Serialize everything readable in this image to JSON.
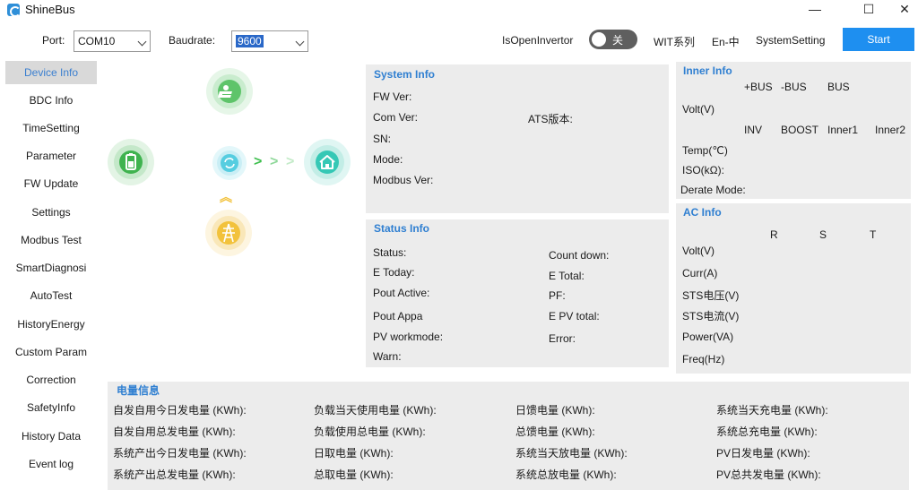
{
  "window": {
    "title": "ShineBus",
    "controls": {
      "minimize": "—",
      "maximize": "☐",
      "close": "✕"
    }
  },
  "toolbar": {
    "port_label": "Port:",
    "port_value": "COM10",
    "baud_label": "Baudrate:",
    "baud_value": "9600",
    "invertor_label": "IsOpenInvertor",
    "toggle_text": "关",
    "wit_label": "WIT系列",
    "lang_label": "En-中",
    "system_setting": "SystemSetting",
    "start_label": "Start"
  },
  "sidebar": {
    "items": [
      {
        "label": "Device Info",
        "active": true
      },
      {
        "label": "BDC Info"
      },
      {
        "label": "TimeSetting"
      },
      {
        "label": "Parameter"
      },
      {
        "label": "FW Update"
      },
      {
        "label": "Settings"
      },
      {
        "label": "Modbus Test"
      },
      {
        "label": "SmartDiagnosi"
      },
      {
        "label": "AutoTest"
      },
      {
        "label": "HistoryEnergy"
      },
      {
        "label": "Custom Param"
      },
      {
        "label": "Correction"
      },
      {
        "label": "SafetyInfo"
      },
      {
        "label": "History Data"
      },
      {
        "label": "Event log"
      }
    ]
  },
  "colors": {
    "accent": "#2f7fd1",
    "start_button": "#1e8ff0",
    "panel_bg": "#ececec",
    "solar_green": "#5ec46a",
    "battery_green": "#3fb34f",
    "converter_cyan": "#56cde0",
    "home_teal": "#35c8b5",
    "grid_yellow": "#f2c23c"
  },
  "diagram": {
    "icons": [
      "solar-panel-icon",
      "battery-icon",
      "converter-icon",
      "home-icon",
      "grid-tower-icon"
    ],
    "flow_arrows": [
      ">",
      ">",
      ">"
    ],
    "up_arrow": "︽"
  },
  "system_info": {
    "title": "System Info",
    "fw_ver": "FW Ver:",
    "com_ver": "Com Ver:",
    "ats_ver": "ATS版本:",
    "sn": "SN:",
    "mode": "Mode:",
    "modbus_ver": "Modbus Ver:"
  },
  "inner_info": {
    "title": "Inner Info",
    "bus_headers": [
      "+BUS",
      "-BUS",
      "BUS"
    ],
    "volt": "Volt(V)",
    "temp_headers": [
      "INV",
      "BOOST",
      "Inner1",
      "Inner2"
    ],
    "temp": "Temp(℃)",
    "iso": "ISO(kΩ):",
    "derate": "Derate Mode:"
  },
  "status_info": {
    "title": "Status Info",
    "left": [
      "Status:",
      "E Today:",
      "Pout Active:",
      "Pout Appa",
      "PV workmode:",
      "Warn:"
    ],
    "right": [
      "Count down:",
      "E Total:",
      "PF:",
      "E PV total:",
      "Error:"
    ]
  },
  "ac_info": {
    "title": "AC Info",
    "phase_headers": [
      "R",
      "S",
      "T"
    ],
    "rows": [
      "Volt(V)",
      "Curr(A)",
      "STS电压(V)",
      "STS电流(V)",
      "Power(VA)",
      "Freq(Hz)"
    ]
  },
  "energy_info": {
    "title": "电量信息",
    "col1": [
      "自发自用今日发电量 (KWh):",
      "自发自用总发电量 (KWh):",
      "系统产出今日发电量 (KWh):",
      "系统产出总发电量 (KWh):"
    ],
    "col2": [
      "负载当天使用电量 (KWh):",
      "负载使用总电量 (KWh):",
      "日取电量 (KWh):",
      "总取电量 (KWh):"
    ],
    "col3": [
      "日馈电量 (KWh):",
      "总馈电量 (KWh):",
      "系统当天放电量 (KWh):",
      "系统总放电量 (KWh):"
    ],
    "col4": [
      "系统当天充电量 (KWh):",
      "系统总充电量 (KWh):",
      "PV日发电量 (KWh):",
      "PV总共发电量 (KWh):"
    ]
  }
}
